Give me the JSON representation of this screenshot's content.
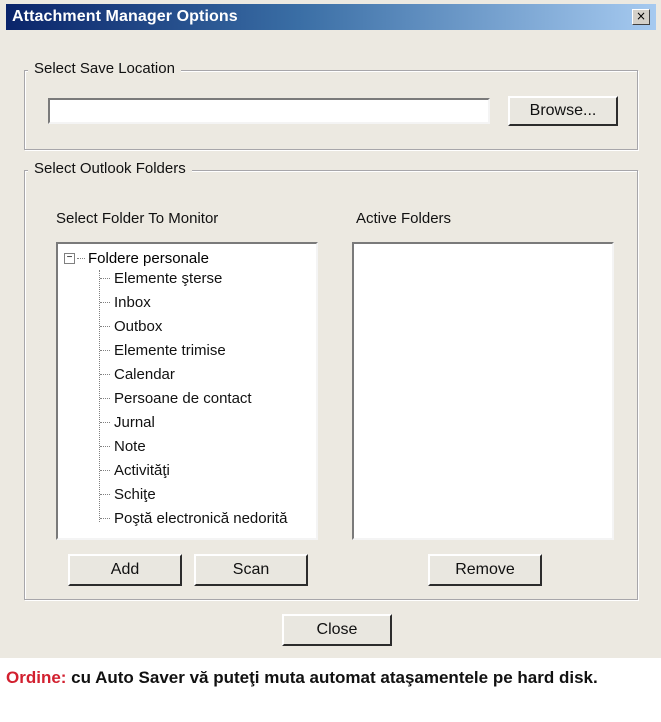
{
  "window": {
    "title": "Attachment Manager Options",
    "close_glyph": "×"
  },
  "save_location": {
    "group_label": "Select Save Location",
    "path_value": "",
    "browse_label": "Browse..."
  },
  "outlook_folders": {
    "group_label": "Select Outlook Folders",
    "monitor_label": "Select Folder To Monitor",
    "active_label": "Active Folders",
    "tree": {
      "root": "Foldere personale",
      "expander": "−",
      "items": [
        "Elemente şterse",
        "Inbox",
        "Outbox",
        "Elemente trimise",
        "Calendar",
        "Persoane de contact",
        "Jurnal",
        "Note",
        "Activităţi",
        "Schiţe",
        "Poştă electronică nedorită"
      ]
    },
    "active_folders": [],
    "add_label": "Add",
    "scan_label": "Scan",
    "remove_label": "Remove"
  },
  "close_label": "Close",
  "caption": {
    "prefix": "Ordine:",
    "text": " cu Auto Saver vă puteţi muta automat ataşamentele pe hard disk."
  },
  "colors": {
    "title_gradient_start": "#0a246a",
    "title_gradient_end": "#a6caf0",
    "dialog_bg": "#ece9e1",
    "caption_accent": "#d2202f"
  }
}
